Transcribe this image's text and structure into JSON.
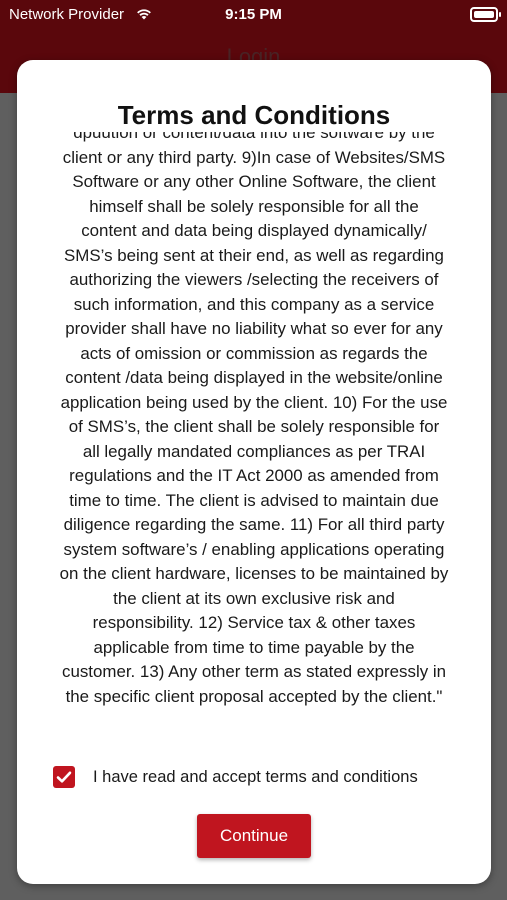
{
  "status_bar": {
    "carrier": "Network Provider",
    "time": "9:15 PM"
  },
  "header": {
    "title": "Login"
  },
  "dialog": {
    "title": "Terms and Conditions",
    "body_lines": [
      "dpuution or content/data into the software by the",
      "client or any third party. 9)In case of Websites/SMS",
      "Software or any other Online Software, the client",
      "himself shall be solely responsible for all the",
      "content and data being displayed dynamically/",
      "SMS’s being sent  at their end, as well as regarding",
      "authorizing the viewers /selecting the receivers of",
      "such information, and this company as a service",
      "provider shall have no liability what so ever for any",
      "acts of omission or commission  as regards the",
      "content /data being displayed in the website/online",
      "application being used by the client. 10) For the use",
      "of SMS’s, the client shall be solely responsible for",
      "all legally mandated compliances as per TRAI",
      "regulations and the IT Act 2000 as amended from",
      "time to time. The client is advised to maintain due",
      "diligence regarding the same. 11) For all third party",
      "system software’s / enabling applications operating",
      "on the client hardware, licenses to be maintained by",
      "the client at its own exclusive risk and",
      "responsibility. 12) Service tax & other taxes",
      "applicable from time to time payable by the",
      "customer. 13) Any other term as stated expressly in",
      "the specific client proposal accepted by the client.\""
    ],
    "accept_label": "I have read and accept terms and conditions",
    "accept_checked": true,
    "continue_label": "Continue"
  },
  "colors": {
    "header": "#5a070c",
    "accent": "#c0151f"
  }
}
